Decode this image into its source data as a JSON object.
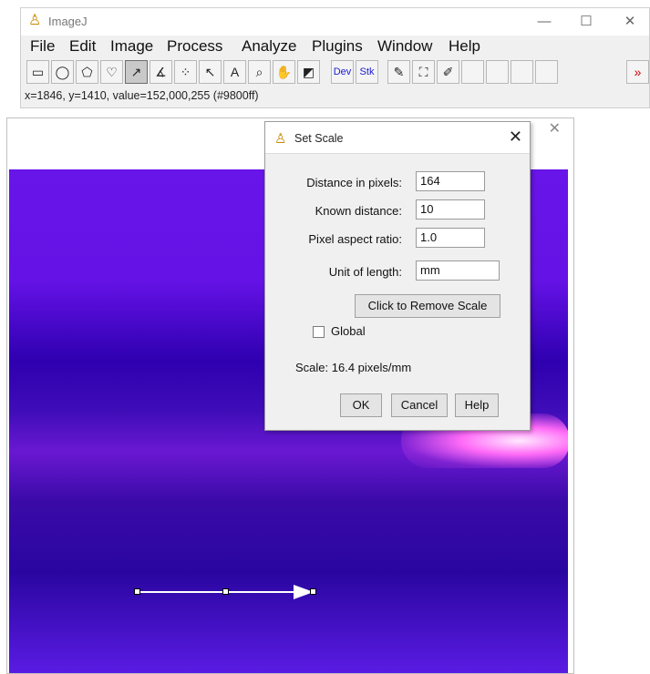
{
  "app": {
    "title": "ImageJ",
    "window_controls": {
      "minimize": "—",
      "maximize": "☐",
      "close": "✕"
    }
  },
  "menu": [
    "File",
    "Edit",
    "Image",
    "Process",
    "Analyze",
    "Plugins",
    "Window",
    "Help"
  ],
  "toolbar": {
    "tools": [
      {
        "name": "rectangle-tool-icon",
        "glyph": "▭",
        "active": false
      },
      {
        "name": "oval-tool-icon",
        "glyph": "◯",
        "active": false
      },
      {
        "name": "polygon-tool-icon",
        "glyph": "⬠",
        "active": false
      },
      {
        "name": "freehand-tool-icon",
        "glyph": "♡",
        "active": false
      },
      {
        "name": "line-tool-icon",
        "glyph": "↗",
        "active": true
      },
      {
        "name": "angle-tool-icon",
        "glyph": "∡",
        "active": false
      },
      {
        "name": "multipoint-tool-icon",
        "glyph": "⁘",
        "active": false
      },
      {
        "name": "wand-tool-icon",
        "glyph": "↖",
        "active": false
      },
      {
        "name": "text-tool-icon",
        "glyph": "A",
        "active": false
      },
      {
        "name": "magnifier-tool-icon",
        "glyph": "⌕",
        "active": false
      },
      {
        "name": "hand-tool-icon",
        "glyph": "✋",
        "active": false
      },
      {
        "name": "color-picker-tool-icon",
        "glyph": "◩",
        "active": false
      },
      {
        "name": "dev-menu-tool",
        "glyph": "Dev",
        "active": false
      },
      {
        "name": "stk-menu-tool",
        "glyph": "Stk",
        "active": false
      },
      {
        "name": "brush-tool-icon",
        "glyph": "✎",
        "active": false
      },
      {
        "name": "flood-fill-tool-icon",
        "glyph": "⛶",
        "active": false
      },
      {
        "name": "pencil-tool-icon",
        "glyph": "✐",
        "active": false
      },
      {
        "name": "more-tools-icon",
        "glyph": "»",
        "active": false
      }
    ]
  },
  "status_bar": "x=1846, y=1410, value=152,000,255 (#9800ff)",
  "image_window": {
    "close": "✕"
  },
  "dialog": {
    "title": "Set Scale",
    "close": "✕",
    "fields": {
      "distance_pixels": {
        "label": "Distance in pixels:",
        "value": "164"
      },
      "known_distance": {
        "label": "Known distance:",
        "value": "10"
      },
      "aspect_ratio": {
        "label": "Pixel aspect ratio:",
        "value": "1.0"
      },
      "unit": {
        "label": "Unit of length:",
        "value": "mm"
      }
    },
    "remove_scale_button": "Click to Remove Scale",
    "global_label": "Global",
    "scale_text": "Scale: 16.4 pixels/mm",
    "ok": "OK",
    "cancel": "Cancel",
    "help": "Help"
  }
}
